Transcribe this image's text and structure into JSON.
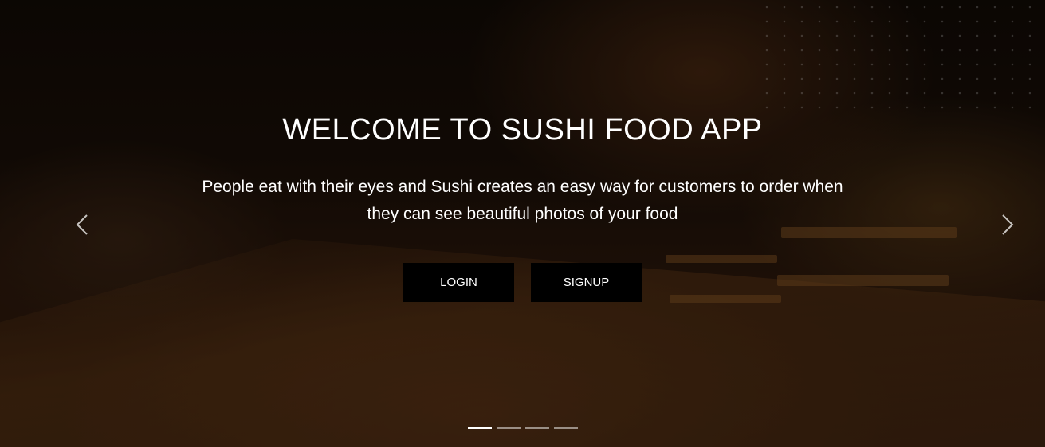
{
  "hero": {
    "title": "WELCOME TO SUSHI FOOD APP",
    "subtitle": "People eat with their eyes and Sushi creates an easy way for customers to order when they can see beautiful photos of your food",
    "login_label": "LOGIN",
    "signup_label": "SIGNUP",
    "background_image": "dimly lit sushi restaurant counter with chefs"
  },
  "carousel": {
    "prev_icon": "chevron-left-icon",
    "next_icon": "chevron-right-icon",
    "slide_count": 4,
    "active_slide": 1
  },
  "colors": {
    "button_bg": "#000000",
    "text": "#ffffff"
  }
}
